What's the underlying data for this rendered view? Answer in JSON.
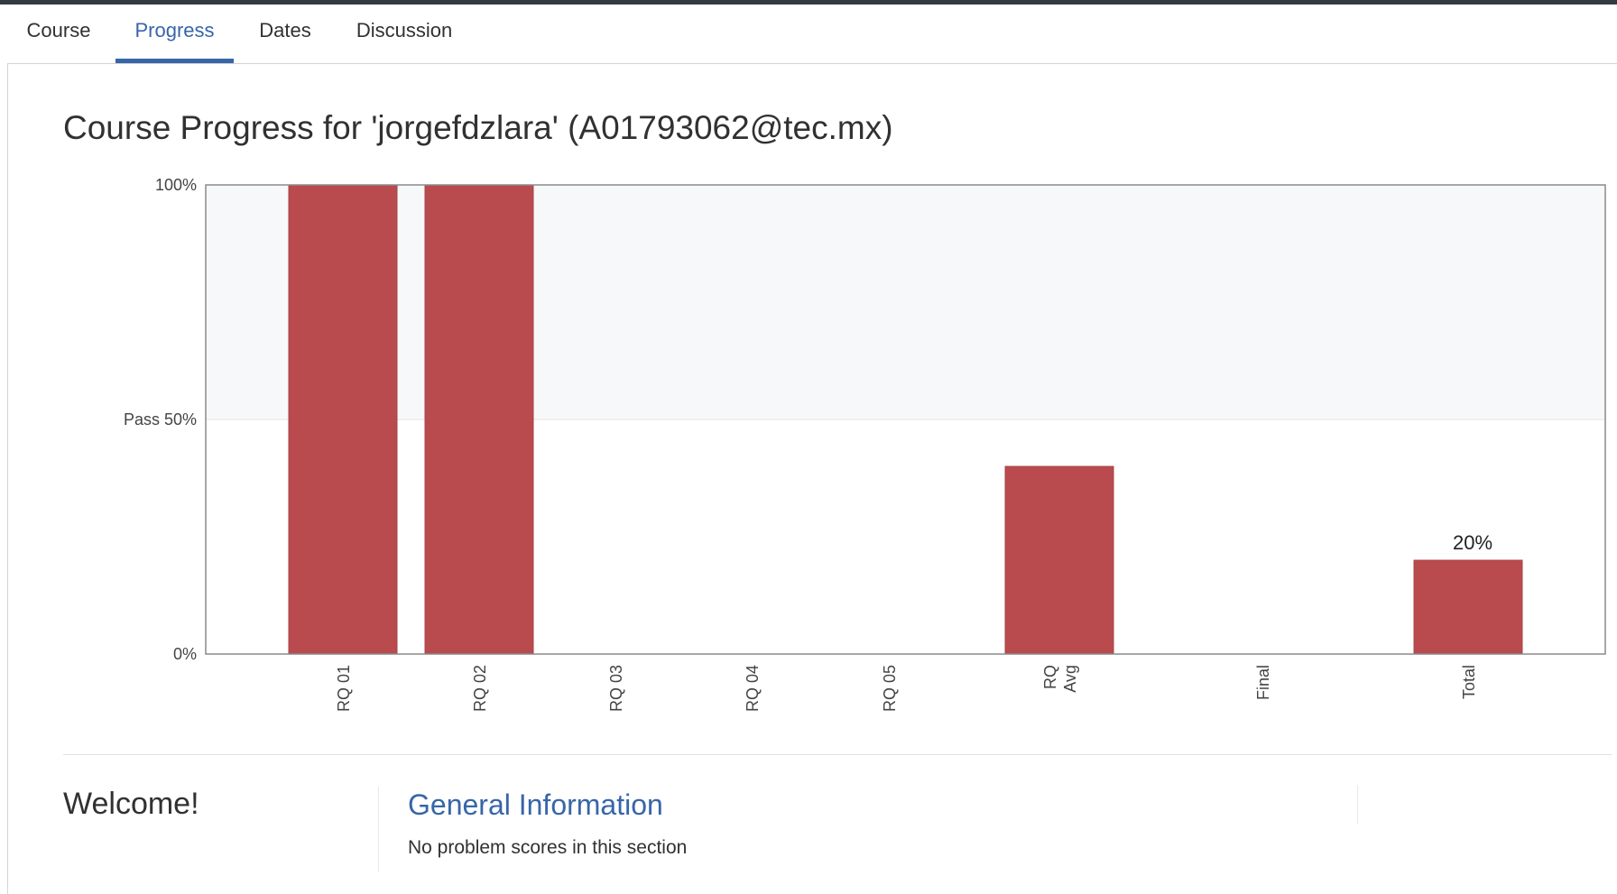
{
  "tabs": [
    {
      "label": "Course",
      "active": false
    },
    {
      "label": "Progress",
      "active": true
    },
    {
      "label": "Dates",
      "active": false
    },
    {
      "label": "Discussion",
      "active": false
    }
  ],
  "page_title": "Course Progress for 'jorgefdzlara' (A01793062@tec.mx)",
  "colors": {
    "accent": "#3766a8",
    "bar": "#b94a4e",
    "pass_band": "#f7f8fa"
  },
  "chart_data": {
    "type": "bar",
    "categories": [
      [
        "RQ 01"
      ],
      [
        "RQ 02"
      ],
      [
        "RQ 03"
      ],
      [
        "RQ 04"
      ],
      [
        "RQ 05"
      ],
      [
        "RQ",
        "Avg"
      ],
      [
        "Final"
      ],
      [
        "Total"
      ]
    ],
    "values": [
      100,
      100,
      0,
      0,
      0,
      40,
      0,
      20
    ],
    "ylim": [
      0,
      100
    ],
    "y_ticks": [
      {
        "value": 0,
        "label": "0%"
      },
      {
        "value": 50,
        "label": "Pass 50%"
      },
      {
        "value": 100,
        "label": "100%"
      }
    ],
    "pass_threshold": 50,
    "data_labels": [
      {
        "index": 7,
        "text": "20%"
      }
    ],
    "title": "",
    "xlabel": "",
    "ylabel": "",
    "legend": "none"
  },
  "sections": {
    "welcome": "Welcome!",
    "general_info_title": "General Information",
    "general_info_text": "No problem scores in this section"
  }
}
